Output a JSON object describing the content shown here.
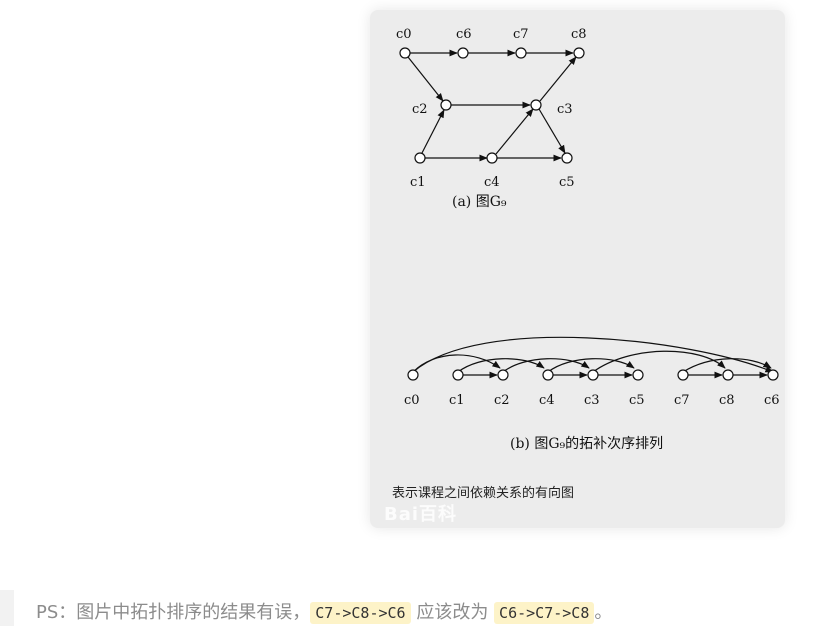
{
  "figure": {
    "graph_a": {
      "nodes": [
        {
          "id": "c0",
          "label": "c0"
        },
        {
          "id": "c6",
          "label": "c6"
        },
        {
          "id": "c7",
          "label": "c7"
        },
        {
          "id": "c8",
          "label": "c8"
        },
        {
          "id": "c2",
          "label": "c2"
        },
        {
          "id": "c3",
          "label": "c3"
        },
        {
          "id": "c1",
          "label": "c1"
        },
        {
          "id": "c4",
          "label": "c4"
        },
        {
          "id": "c5",
          "label": "c5"
        }
      ],
      "caption": "(a) 图G₉"
    },
    "graph_b": {
      "order": [
        "c0",
        "c1",
        "c2",
        "c4",
        "c3",
        "c5",
        "c7",
        "c8",
        "c6"
      ],
      "caption": "(b) 图G₉的拓补次序排列"
    },
    "description": "表示课程之间依赖关系的有向图",
    "watermark": "Bai百科"
  },
  "note": {
    "prefix": "PS：图片中拓扑排序的结果有误，",
    "wrong": "C7->C8->C6",
    "middle": " 应该改为 ",
    "right": "C6->C7->C8",
    "suffix": "。"
  }
}
